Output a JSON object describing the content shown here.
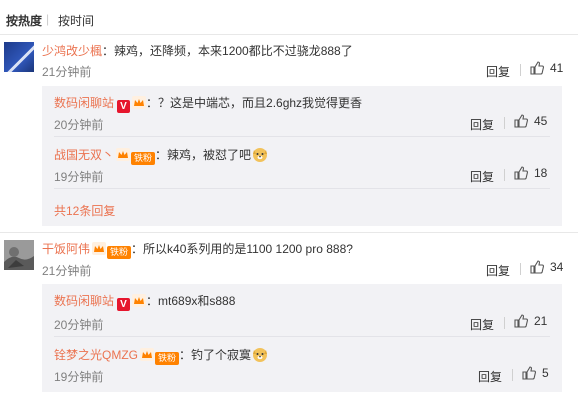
{
  "sort": {
    "hot": "按热度",
    "time": "按时间"
  },
  "comments": [
    {
      "user": "少鸿改少楓",
      "text": "：辣鸡，还降频，本来1200都比不过骁龙888了",
      "time": "21分钟前",
      "reply_label": "回复",
      "likes": "41",
      "replies": [
        {
          "user": "数码闲聊站",
          "badge_v": "V",
          "text": "：？这是中端芯，而且2.6ghz我觉得更香",
          "time": "20分钟前",
          "reply_label": "回复",
          "likes": "45"
        },
        {
          "user": "战国无双丶",
          "badge_fan": "铁粉",
          "text": "：辣鸡，被怼了吧",
          "time": "19分钟前",
          "reply_label": "回复",
          "likes": "18"
        }
      ],
      "more": "共12条回复"
    },
    {
      "user": "干饭阿伟",
      "badge_fan": "铁粉",
      "text": "：所以k40系列用的是1100 1200 pro 888?",
      "time": "21分钟前",
      "reply_label": "回复",
      "likes": "34",
      "replies": [
        {
          "user": "数码闲聊站",
          "badge_v": "V",
          "text": "：mt689x和s888",
          "time": "20分钟前",
          "reply_label": "回复",
          "likes": "21"
        },
        {
          "user": "铨梦之光QMZG",
          "badge_fan": "铁粉",
          "text": "：钓了个寂寞",
          "time": "19分钟前",
          "reply_label": "回复",
          "likes": "5"
        }
      ]
    }
  ],
  "colors": {
    "username": "#eb7350",
    "reply_bg": "#f2f2f5",
    "badge_v": "#e6162d",
    "badge_fan": "#ff8200"
  },
  "icons": [
    "thumbs-up-icon",
    "crown-icon",
    "doge-emoji"
  ]
}
